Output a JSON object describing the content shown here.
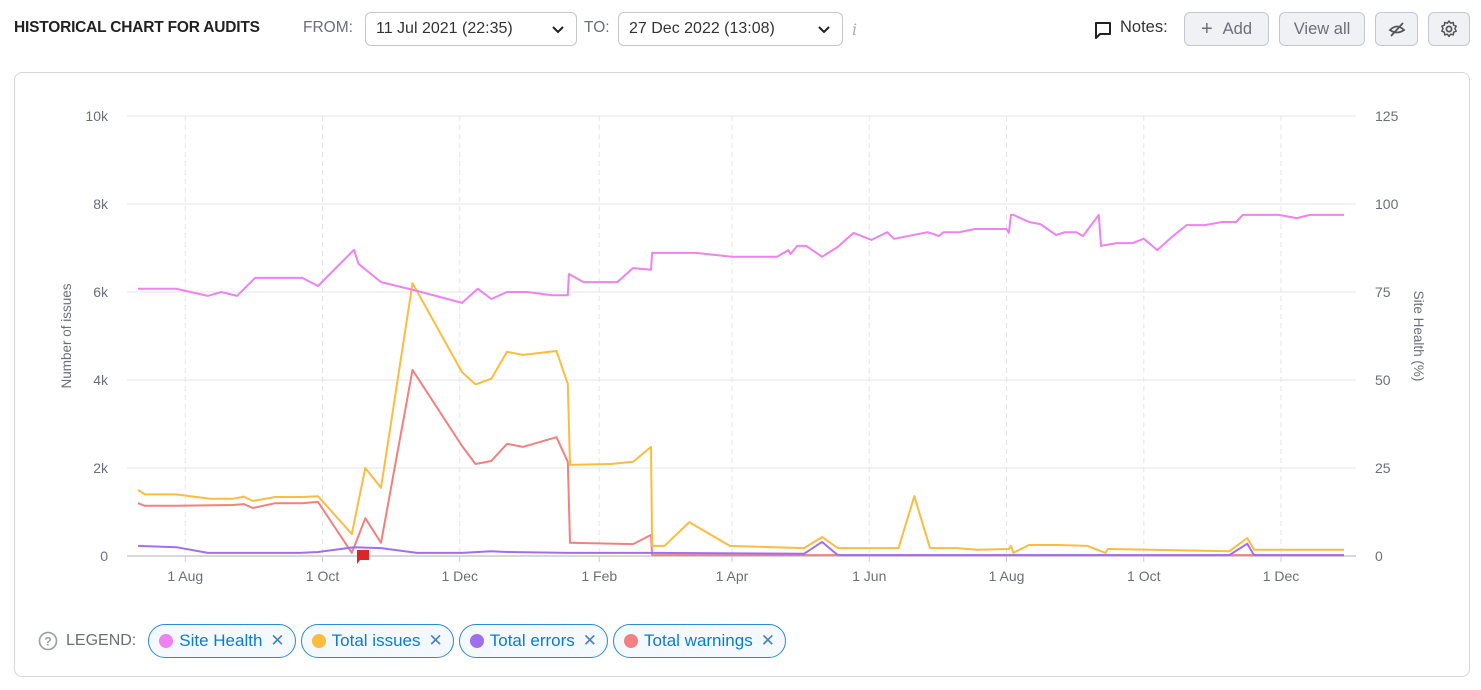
{
  "header": {
    "title": "HISTORICAL CHART FOR AUDITS",
    "from_label": "FROM:",
    "from_value": "11 Jul 2021 (22:35)",
    "to_label": "TO:",
    "to_value": "27 Dec 2022 (13:08)",
    "info_icon": "i",
    "notes_label": "Notes:",
    "add_label": "Add",
    "add_icon": "+",
    "view_all_label": "View all"
  },
  "legend": {
    "label": "LEGEND:",
    "items": [
      {
        "name": "Site Health",
        "color": "#ee82ee",
        "remove": "✕"
      },
      {
        "name": "Total issues",
        "color": "#fbbc3f",
        "remove": "✕"
      },
      {
        "name": "Total errors",
        "color": "#a26ef0",
        "remove": "✕"
      },
      {
        "name": "Total warnings",
        "color": "#f28080",
        "remove": "✕"
      }
    ]
  },
  "chart_data": {
    "type": "line",
    "title": "",
    "x_start_date": "2021-07-11",
    "x_unit": "days since 2021-07-11",
    "xlim": [
      0,
      536
    ],
    "x_ticks": [
      {
        "label": "1 Aug",
        "day": 21
      },
      {
        "label": "1 Oct",
        "day": 82
      },
      {
        "label": "1 Dec",
        "day": 143
      },
      {
        "label": "1 Feb",
        "day": 205
      },
      {
        "label": "1 Apr",
        "day": 264
      },
      {
        "label": "1 Jun",
        "day": 325
      },
      {
        "label": "1 Aug",
        "day": 386
      },
      {
        "label": "1 Oct",
        "day": 447
      },
      {
        "label": "1 Dec",
        "day": 508
      }
    ],
    "ylabel": "Number of issues",
    "ylim": [
      0,
      10000
    ],
    "y_ticks": [
      "0",
      "2k",
      "4k",
      "6k",
      "8k",
      "10k"
    ],
    "y_tick_values": [
      0,
      2000,
      4000,
      6000,
      8000,
      10000
    ],
    "y2label": "Site Health (%)",
    "y2lim": [
      0,
      125
    ],
    "y2_ticks": [
      "0",
      "25",
      "50",
      "75",
      "100",
      "125"
    ],
    "y2_tick_values": [
      0,
      25,
      50,
      75,
      100,
      125
    ],
    "grid": true,
    "note_marker_day": 100,
    "note_marker_color": "#e02424",
    "series": [
      {
        "name": "Site Health",
        "axis": "right",
        "color": "#ee82ee",
        "x": [
          0,
          17,
          31,
          37,
          44,
          52,
          73,
          80,
          96,
          98,
          108,
          124,
          144,
          151,
          157,
          164,
          173,
          184,
          191,
          191.5,
          198,
          213,
          220,
          228,
          228.5,
          248,
          264,
          284,
          289,
          290,
          293,
          297,
          304,
          311,
          318,
          326,
          333,
          333,
          336,
          351,
          356,
          358,
          365,
          372,
          386,
          387,
          388,
          389,
          396,
          401,
          408,
          412,
          417,
          420,
          427,
          428,
          435,
          442,
          447,
          453,
          460,
          466,
          474,
          482,
          488,
          491,
          507,
          515,
          521,
          536
        ],
        "y": [
          75.9,
          75.9,
          73.9,
          75.0,
          73.9,
          79.0,
          79.0,
          76.7,
          87.0,
          83.0,
          77.8,
          75.3,
          71.9,
          75.9,
          73.0,
          75.0,
          75.0,
          74.1,
          74.1,
          80.1,
          77.8,
          77.8,
          81.8,
          81.3,
          86.1,
          86.1,
          85.0,
          85.0,
          86.9,
          85.8,
          88.1,
          88.1,
          85.0,
          87.8,
          91.8,
          89.8,
          92.0,
          92.0,
          90.1,
          92.0,
          90.9,
          92.0,
          92.0,
          92.9,
          92.9,
          91.8,
          96.9,
          96.9,
          94.9,
          94.3,
          91.2,
          92.0,
          92.0,
          90.9,
          96.9,
          88.1,
          88.9,
          88.9,
          90.1,
          86.9,
          90.9,
          94.0,
          94.0,
          94.9,
          94.9,
          96.9,
          96.9,
          96.0,
          96.9,
          96.9
        ]
      },
      {
        "name": "Total issues",
        "axis": "left",
        "color": "#fbbc3f",
        "x": [
          0,
          3,
          17,
          32,
          42,
          47,
          51,
          61,
          73,
          80,
          95,
          101,
          108,
          122,
          144,
          150,
          157,
          164,
          171,
          186,
          191,
          192,
          210,
          220,
          228,
          228.5,
          234,
          245,
          263,
          296,
          304,
          311,
          338,
          345,
          352,
          364,
          373,
          387,
          388,
          389,
          396,
          409,
          422,
          430,
          431,
          485,
          493,
          496,
          536
        ],
        "y": [
          1500,
          1400,
          1400,
          1300,
          1300,
          1350,
          1250,
          1340,
          1340,
          1360,
          500,
          2000,
          1550,
          6200,
          4180,
          3900,
          4030,
          4640,
          4570,
          4660,
          3910,
          2070,
          2090,
          2140,
          2480,
          230,
          230,
          770,
          230,
          180,
          430,
          180,
          180,
          1360,
          180,
          180,
          140,
          160,
          230,
          70,
          250,
          250,
          230,
          70,
          160,
          110,
          410,
          140,
          140
        ]
      },
      {
        "name": "Total errors",
        "axis": "left",
        "color": "#a26ef0",
        "x": [
          0,
          17,
          31,
          72,
          80,
          96,
          108,
          124,
          144,
          157,
          164,
          191,
          228,
          296,
          304,
          311,
          485,
          493,
          496,
          536
        ],
        "y": [
          230,
          200,
          70,
          70,
          90,
          200,
          180,
          70,
          70,
          110,
          90,
          70,
          70,
          50,
          320,
          20,
          20,
          280,
          20,
          20
        ]
      },
      {
        "name": "Total warnings",
        "axis": "left",
        "color": "#f28080",
        "x": [
          0,
          3,
          17,
          42,
          47,
          51,
          61,
          73,
          80,
          95,
          101,
          108,
          122,
          144,
          150,
          157,
          164,
          171,
          186,
          191,
          192,
          220,
          228,
          228.5,
          536
        ],
        "y": [
          1200,
          1140,
          1140,
          1160,
          1180,
          1090,
          1200,
          1200,
          1230,
          70,
          860,
          300,
          4230,
          2500,
          2090,
          2160,
          2550,
          2480,
          2700,
          2140,
          300,
          270,
          480,
          20,
          20
        ]
      }
    ]
  }
}
